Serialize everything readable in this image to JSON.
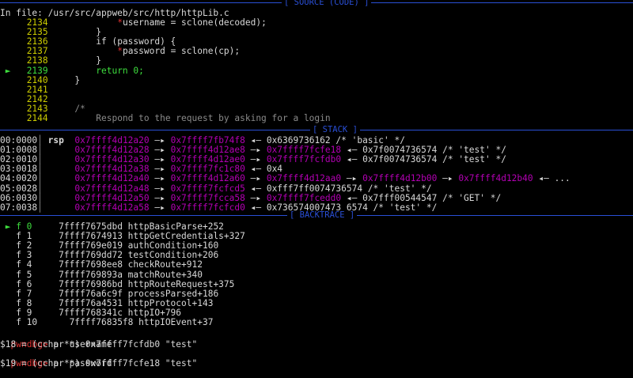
{
  "source": {
    "header": "[ SOURCE (CODE) ]",
    "file_label": "In file: /usr/src/appweb/src/http/httpLib.c",
    "lines": [
      {
        "no": "2134",
        "arrow": "",
        "text": "            *username = sclone(decoded);"
      },
      {
        "no": "2135",
        "arrow": "",
        "text": "        }"
      },
      {
        "no": "2136",
        "arrow": "",
        "text": "        if (password) {"
      },
      {
        "no": "2137",
        "arrow": "",
        "text": "            *password = sclone(cp);"
      },
      {
        "no": "2138",
        "arrow": "",
        "text": "        }"
      },
      {
        "no": "2139",
        "arrow": "►",
        "text": "        return 0;"
      },
      {
        "no": "2140",
        "arrow": "",
        "text": "    }"
      },
      {
        "no": "2141",
        "arrow": "",
        "text": ""
      },
      {
        "no": "2142",
        "arrow": "",
        "text": ""
      },
      {
        "no": "2143",
        "arrow": "",
        "text": "    /*"
      },
      {
        "no": "2144",
        "arrow": "",
        "text": "        Respond to the request by asking for a login"
      }
    ]
  },
  "stack": {
    "header": "[ STACK ]",
    "rows": [
      {
        "off": "00:0000",
        "reg": "rsp",
        "chain": [
          {
            "t": "0x7ffff4d12a20",
            "c": "m"
          },
          {
            "t": " —▸ ",
            "c": "w"
          },
          {
            "t": "0x7ffff7fb74f8",
            "c": "m"
          },
          {
            "t": " ◂— ",
            "c": "w"
          },
          {
            "t": "0x6369736162 /* 'basic' */",
            "c": "w"
          }
        ]
      },
      {
        "off": "01:0008",
        "reg": "",
        "chain": [
          {
            "t": "0x7ffff4d12a28",
            "c": "m"
          },
          {
            "t": " —▸ ",
            "c": "w"
          },
          {
            "t": "0x7ffff4d12ae8",
            "c": "m"
          },
          {
            "t": " —▸ ",
            "c": "w"
          },
          {
            "t": "0x7ffff7fcfe18",
            "c": "m"
          },
          {
            "t": " ◂— ",
            "c": "w"
          },
          {
            "t": "0x7f0074736574 /* 'test' */",
            "c": "w"
          }
        ]
      },
      {
        "off": "02:0010",
        "reg": "",
        "chain": [
          {
            "t": "0x7ffff4d12a30",
            "c": "m"
          },
          {
            "t": " —▸ ",
            "c": "w"
          },
          {
            "t": "0x7ffff4d12ae0",
            "c": "m"
          },
          {
            "t": " —▸ ",
            "c": "w"
          },
          {
            "t": "0x7ffff7fcfdb0",
            "c": "m"
          },
          {
            "t": " ◂— ",
            "c": "w"
          },
          {
            "t": "0x7f0074736574 /* 'test' */",
            "c": "w"
          }
        ]
      },
      {
        "off": "03:0018",
        "reg": "",
        "chain": [
          {
            "t": "0x7ffff4d12a38",
            "c": "m"
          },
          {
            "t": " —▸ ",
            "c": "w"
          },
          {
            "t": "0x7ffff7fc1c80",
            "c": "m"
          },
          {
            "t": " ◂— ",
            "c": "w"
          },
          {
            "t": "0x4",
            "c": "w"
          }
        ]
      },
      {
        "off": "04:0020",
        "reg": "",
        "chain": [
          {
            "t": "0x7ffff4d12a40",
            "c": "m"
          },
          {
            "t": " —▸ ",
            "c": "w"
          },
          {
            "t": "0x7ffff4d12a60",
            "c": "m"
          },
          {
            "t": " —▸ ",
            "c": "w"
          },
          {
            "t": "0x7ffff4d12aa0",
            "c": "m"
          },
          {
            "t": " —▸ ",
            "c": "w"
          },
          {
            "t": "0x7ffff4d12b00",
            "c": "m"
          },
          {
            "t": " —▸ ",
            "c": "w"
          },
          {
            "t": "0x7ffff4d12b40",
            "c": "m"
          },
          {
            "t": " ◂— ...",
            "c": "w"
          }
        ]
      },
      {
        "off": "05:0028",
        "reg": "",
        "chain": [
          {
            "t": "0x7ffff4d12a48",
            "c": "m"
          },
          {
            "t": " —▸ ",
            "c": "w"
          },
          {
            "t": "0x7ffff7fcfcd5",
            "c": "m"
          },
          {
            "t": " ◂— ",
            "c": "w"
          },
          {
            "t": "0xfff7ff0074736574 /* 'test' */",
            "c": "w"
          }
        ]
      },
      {
        "off": "06:0030",
        "reg": "",
        "chain": [
          {
            "t": "0x7ffff4d12a50",
            "c": "m"
          },
          {
            "t": " —▸ ",
            "c": "w"
          },
          {
            "t": "0x7ffff7fcca58",
            "c": "m"
          },
          {
            "t": " —▸ ",
            "c": "w"
          },
          {
            "t": "0x7ffff7fcedd0",
            "c": "m"
          },
          {
            "t": " ◂— ",
            "c": "w"
          },
          {
            "t": "0x7fff00544547 /* 'GET' */",
            "c": "w"
          }
        ]
      },
      {
        "off": "07:0038",
        "reg": "",
        "chain": [
          {
            "t": "0x7ffff4d12a58",
            "c": "m"
          },
          {
            "t": " —▸ ",
            "c": "w"
          },
          {
            "t": "0x7ffff7fcfcd0",
            "c": "m"
          },
          {
            "t": " ◂— ",
            "c": "w"
          },
          {
            "t": "0x736574007473 6574 /* 'test' */",
            "c": "w"
          }
        ]
      }
    ]
  },
  "backtrace": {
    "header": "[ BACKTRACE ]",
    "frames": [
      {
        "marker": "► f 0",
        "addr": "7ffff7675dbd",
        "sym": "httpBasicParse+252"
      },
      {
        "marker": "  f 1",
        "addr": "7ffff7674913",
        "sym": "httpGetCredentials+327"
      },
      {
        "marker": "  f 2",
        "addr": "7ffff769e019",
        "sym": "authCondition+160"
      },
      {
        "marker": "  f 3",
        "addr": "7ffff769dd72",
        "sym": "testCondition+206"
      },
      {
        "marker": "  f 4",
        "addr": "7ffff7698ee8",
        "sym": "checkRoute+912"
      },
      {
        "marker": "  f 5",
        "addr": "7ffff769893a",
        "sym": "matchRoute+340"
      },
      {
        "marker": "  f 6",
        "addr": "7ffff76986bd",
        "sym": "httpRouteRequest+375"
      },
      {
        "marker": "  f 7",
        "addr": "7ffff76a6c9f",
        "sym": "processParsed+186"
      },
      {
        "marker": "  f 8",
        "addr": "7ffff76a4531",
        "sym": "httpProtocol+143"
      },
      {
        "marker": "  f 9",
        "addr": "7ffff768341c",
        "sym": "httpIO+796"
      },
      {
        "marker": "  f 10",
        "addr": " 7ffff76835f8",
        "sym": "httpIOEvent+37"
      }
    ]
  },
  "console": {
    "prompt": "pwndbg>",
    "cmd1": " p *username",
    "out1": "$18 = (cchar *) 0x7ffff7fcfdb0 \"test\"",
    "cmd2": " p *password",
    "out2": "$19 = (cchar *) 0x7ffff7fcfe18 \"test\"",
    "cmd3": " "
  },
  "colors": {
    "divider": "#2a4fd6",
    "address": "#b300b3",
    "line_number": "#cdcd00",
    "current_line": "#3ede3e",
    "prompt": "#e03030"
  }
}
